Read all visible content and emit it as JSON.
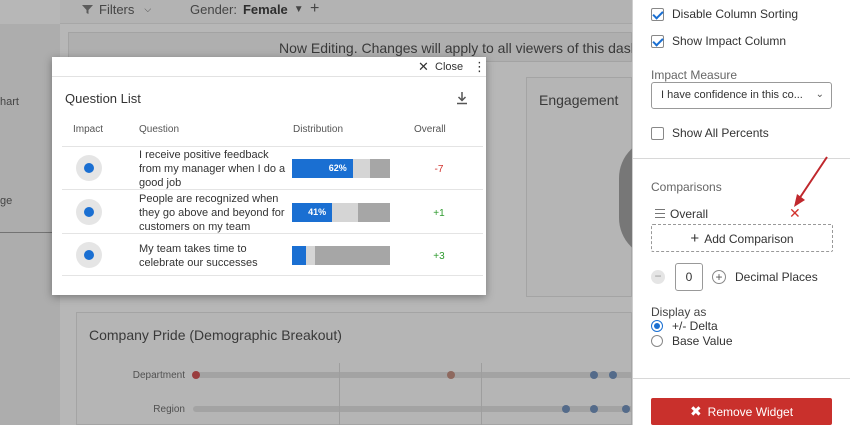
{
  "toolbar": {
    "filters_label": "Filters",
    "gender_label": "Gender:",
    "gender_value": "Female",
    "add_icon": "plus-icon"
  },
  "left_stub": {
    "line1": "hart",
    "line2": "ge"
  },
  "banner": {
    "text": "Now Editing. Changes will apply to all viewers of this dashboard"
  },
  "engagement": {
    "title": "Engagement"
  },
  "company_pride": {
    "title": "Company Pride (Demographic Breakout)",
    "rows": [
      "Department",
      "Region"
    ]
  },
  "question_list": {
    "close_label": "Close",
    "title": "Question List",
    "headers": {
      "impact": "Impact",
      "question": "Question",
      "distribution": "Distribution",
      "overall": "Overall"
    },
    "rows": [
      {
        "question": "I receive positive feedback from my manager when I do a good job",
        "dist_label": "62%",
        "dist_positive": 0.62,
        "dist_neutral": 0.18,
        "overall": "-7"
      },
      {
        "question": "People are recognized when they go above and beyond for customers on my team",
        "dist_label": "41%",
        "dist_positive": 0.41,
        "dist_neutral": 0.26,
        "overall": "+1"
      },
      {
        "question": "My team takes time to celebrate our successes",
        "dist_label": "",
        "dist_positive": 0.14,
        "dist_neutral": 0.09,
        "overall": "+3"
      }
    ]
  },
  "panel": {
    "disable_sorting": {
      "label": "Disable Column Sorting",
      "checked": true
    },
    "show_impact": {
      "label": "Show Impact Column",
      "checked": true
    },
    "impact_measure_label": "Impact Measure",
    "impact_measure_value": "I have confidence in this co...",
    "show_all_percents": {
      "label": "Show All Percents",
      "checked": false
    },
    "comparisons_label": "Comparisons",
    "comparison_item": "Overall",
    "add_comparison": "Add Comparison",
    "decimal_value": "0",
    "decimal_label": "Decimal Places",
    "display_as_label": "Display as",
    "display_options": [
      "+/- Delta",
      "Base Value"
    ],
    "display_selected": "+/- Delta",
    "remove_widget": "Remove Widget"
  },
  "colors": {
    "accent": "#1a6fd2",
    "danger": "#c9302c",
    "negative": "#d2322d",
    "positive": "#2e9a2e"
  }
}
